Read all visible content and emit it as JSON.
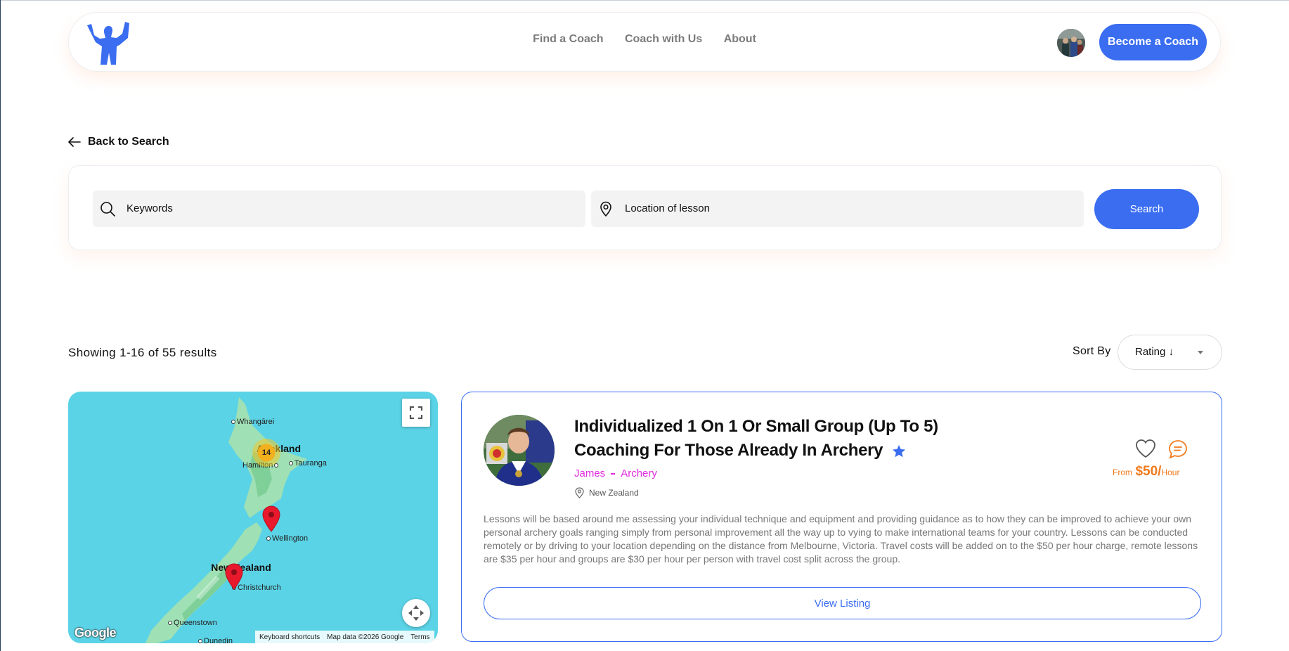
{
  "header": {
    "logo_icon": "athlete-silhouette-icon",
    "nav": [
      "Find a Coach",
      "Coach with Us",
      "About"
    ],
    "become_coach_label": "Become a Coach"
  },
  "back_label": "Back to Search",
  "search": {
    "keywords_text": "Keywords",
    "location_text": "Location of lesson",
    "button_label": "Search"
  },
  "results": {
    "count_text": "Showing 1-16 of 55 results",
    "sort_label": "Sort By",
    "sort_value": "Rating ↓"
  },
  "map": {
    "cluster_count": "14",
    "labels": {
      "whangarei": "Whangārei",
      "auckland": "Auckland",
      "hamilton": "Hamilton",
      "tauranga": "Tauranga",
      "wellington": "Wellington",
      "new_zealand": "New Zealand",
      "christchurch": "Christchurch",
      "queenstown": "Queenstown",
      "dunedin": "Dunedin"
    },
    "google": "Google",
    "shortcuts": "Keyboard shortcuts",
    "map_data": "Map data ©2026 Google",
    "terms": "Terms",
    "colors": {
      "water": "#5bd3e6",
      "land": "#9fe0b4",
      "marker": "#e8192c"
    }
  },
  "listing": {
    "title": "Individualized 1 On 1 Or Small Group (Up To 5) Coaching For Those Already In Archery",
    "coach_name": "James",
    "sport": "Archery",
    "location": "New Zealand",
    "price_from": "From",
    "price_amount": "$50/",
    "price_unit": "Hour",
    "description": "Lessons will be based around me assessing your individual technique and equipment and providing guidance as to how they can be improved to achieve your own personal archery goals ranging simply from personal improvement all the way up to vying to make international teams for your country. Lessons can be conducted remotely or by driving to your location depending on the distance from Melbourne, Victoria. Travel costs will be added on to the $50 per hour charge, remote lessons are $35 per hour and groups are $30 per hour per person with travel cost split across the group.",
    "view_label": "View Listing"
  },
  "colors": {
    "accent": "#3a6df0",
    "magenta": "#e02adf",
    "orange": "#f07a1c"
  }
}
